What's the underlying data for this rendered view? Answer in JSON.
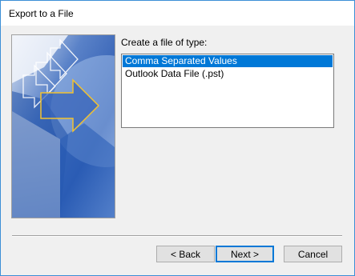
{
  "window": {
    "title": "Export to a File"
  },
  "main": {
    "prompt": "Create a file of type:",
    "file_types": [
      {
        "label": "Comma Separated Values",
        "selected": true
      },
      {
        "label": "Outlook Data File (.pst)",
        "selected": false
      }
    ]
  },
  "buttons": {
    "back": "< Back",
    "next": "Next >",
    "cancel": "Cancel"
  },
  "colors": {
    "accent": "#0078d7",
    "window_border": "#3c8fd6",
    "art_blue_dark": "#1e4fa6",
    "art_blue_light": "#8fb1e6",
    "arrow_outline": "#f2c230"
  }
}
